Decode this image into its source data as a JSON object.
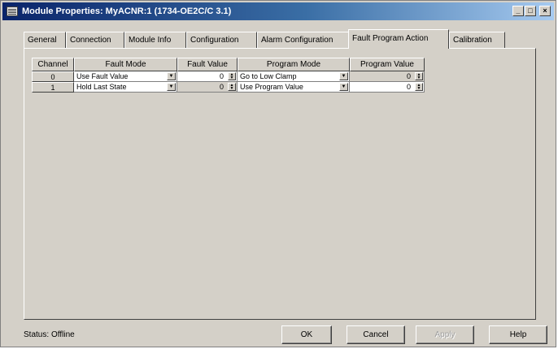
{
  "window": {
    "title": "Module Properties: MyACNR:1 (1734-OE2C/C 3.1)",
    "controls": {
      "minimize": "_",
      "maximize": "□",
      "close": "×"
    }
  },
  "tabs": [
    {
      "label": "General"
    },
    {
      "label": "Connection"
    },
    {
      "label": "Module Info"
    },
    {
      "label": "Configuration"
    },
    {
      "label": "Alarm Configuration"
    },
    {
      "label": "Fault Program Action",
      "active": true
    },
    {
      "label": "Calibration"
    }
  ],
  "table": {
    "headers": [
      "Channel",
      "Fault Mode",
      "Fault Value",
      "Program Mode",
      "Program Value"
    ],
    "rows": [
      {
        "channel": "0",
        "fault_mode": "Use Fault Value",
        "fault_value": "0",
        "program_mode": "Go to Low Clamp",
        "program_value": "0"
      },
      {
        "channel": "1",
        "fault_mode": "Hold Last State",
        "fault_value": "0",
        "program_mode": "Use Program Value",
        "program_value": "0"
      }
    ]
  },
  "status": {
    "label": "Status:",
    "value": "Offline"
  },
  "buttons": {
    "ok": "OK",
    "cancel": "Cancel",
    "apply": "Apply",
    "help": "Help"
  },
  "colors": {
    "face": "#d4d0c8",
    "title_start": "#0a246a",
    "title_end": "#a6caf0"
  }
}
